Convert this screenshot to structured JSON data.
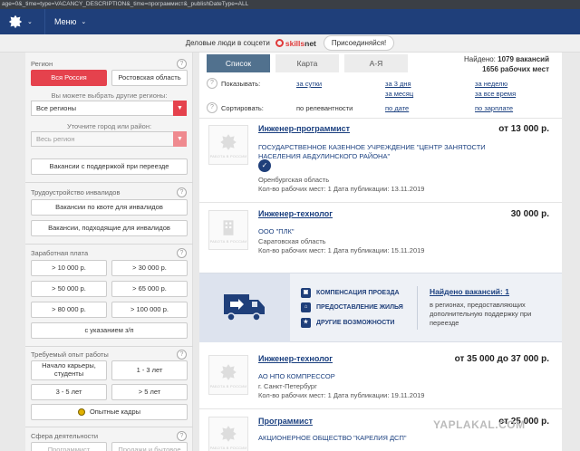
{
  "browser": {
    "url": "age=0&_time=type=VACANCY_DESCRIPTION&_time=программист&_publishDateType=ALL"
  },
  "topnav": {
    "menu_label": "Меню",
    "caret": "⌄"
  },
  "promo": {
    "text": "Деловые люди в соцсети",
    "logo_skills": "skills",
    "logo_net": "net",
    "join_label": "Присоединяйся!"
  },
  "sidebar": {
    "region": {
      "label": "Регион",
      "all_russia": "Вся Россия",
      "rostov": "Ростовская область",
      "hint": "Вы можете выбрать другие регионы:",
      "select_value": "Все регионы",
      "city_hint": "Уточните город или район:",
      "city_value": "Весь регион",
      "relocation_button": "Вакансии с поддержкой при переезде"
    },
    "disabled": {
      "label": "Трудоустройство инвалидов",
      "quota_button": "Вакансии по квоте для инвалидов",
      "suitable_button": "Вакансии, подходящие для инвалидов"
    },
    "salary": {
      "label": "Заработная плата",
      "options": [
        "> 10 000 р.",
        "> 30 000 р.",
        "> 50 000 р.",
        "> 65 000 р.",
        "> 80 000 р.",
        "> 100 000 р."
      ],
      "with_salary": "с указанием з/п"
    },
    "experience": {
      "label": "Требуемый опыт работы",
      "opt1": "Начало карьеры, студенты",
      "opt2": "1 - 3 лет",
      "opt3": "3 - 5 лет",
      "opt4": "> 5 лет",
      "experienced": "Опытные кадры"
    },
    "sphere": {
      "label": "Сфера деятельности",
      "opt1": "Программист",
      "opt2": "Продажи и бытовое"
    }
  },
  "main": {
    "tabs": {
      "list": "Список",
      "map": "Карта",
      "az": "А-Я"
    },
    "found": {
      "prefix": "Найдено:",
      "vacancies": "1079 вакансий",
      "places": "1656 рабочих мест"
    },
    "filters": {
      "show_label": "Показывать:",
      "day": "за сутки",
      "three_days": "за 3 дня",
      "week": "за неделю",
      "month": "за месяц",
      "all_time": "за все время",
      "sort_label": "Сортировать:",
      "relevance": "по релевантности",
      "by_date": "по дате",
      "by_salary": "по зарплате"
    },
    "vacancies": [
      {
        "title": "Инженер-программист",
        "salary": "от 13 000 р.",
        "org": "ГОСУДАРСТВЕННОЕ КАЗЕННОЕ УЧРЕЖДЕНИЕ \"ЦЕНТР ЗАНЯТОСТИ НАСЕЛЕНИЯ АБДУЛИНСКОГО РАЙОНА\"",
        "region": "Оренбургская область",
        "meta": "Кол-во рабочих мест: 1  Дата публикации: 13.11.2019"
      },
      {
        "title": "Инженер-технолог",
        "salary": "30 000 р.",
        "org": "ООО \"ПЛК\"",
        "region": "Саратовская область",
        "meta": "Кол-во рабочих мест: 1  Дата публикации: 15.11.2019"
      },
      {
        "title": "Инженер-технолог",
        "salary": "от 35 000 до 37 000 р.",
        "org": "АО НПО КОМПРЕССОР",
        "region": "г. Санкт-Петербург",
        "meta": "Кол-во рабочих мест: 1  Дата публикации: 19.11.2019"
      },
      {
        "title": "Программист",
        "salary": "от 25 000 р.",
        "org": "АКЦИОНЕРНОЕ ОБЩЕСТВО \"КАРЕЛИЯ ДСП\""
      }
    ],
    "banner": {
      "item1": "КОМПЕНСАЦИЯ ПРОЕЗДА",
      "item2": "ПРЕДОСТАВЛЕНИЕ ЖИЛЬЯ",
      "item3": "ДРУГИЕ ВОЗМОЖНОСТИ",
      "link": "Найдено вакансий: 1",
      "desc": "в регионах, предоставляющих дополнительную поддержку при переезде"
    },
    "logo_text": "РАБОТА В РОССИИ"
  },
  "watermark": "YAPLAKAL.COM",
  "colors": {
    "nav": "#1f3f7a",
    "accent_red": "#e5424d",
    "tab_active": "#51718e",
    "link": "#1a3f7f"
  },
  "icons": [
    "emblem-icon",
    "chevron-down-icon",
    "help-icon",
    "check-icon",
    "truck-icon",
    "bus-icon",
    "house-icon",
    "star-icon",
    "medal-icon"
  ]
}
